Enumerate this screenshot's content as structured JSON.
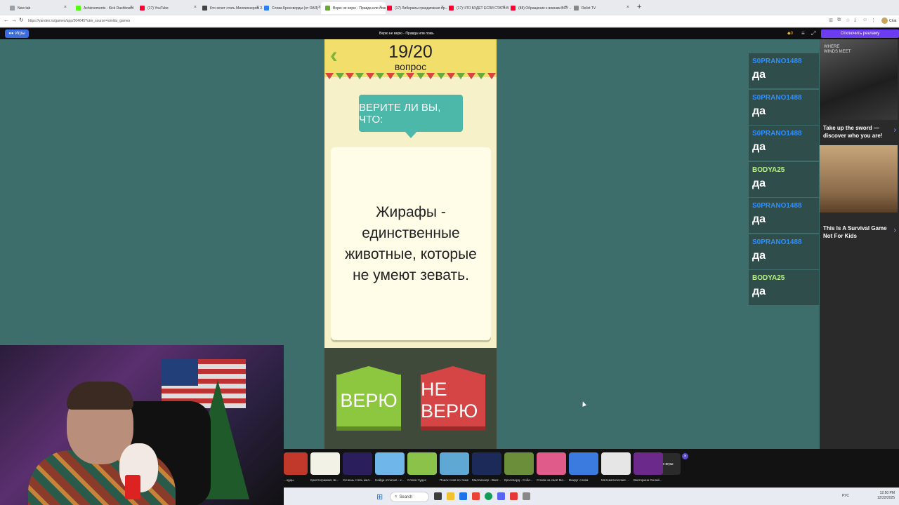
{
  "browser": {
    "tabs": [
      {
        "label": "New tab",
        "color": "#9aa0a6"
      },
      {
        "label": "Achievements - Kick Dashboard",
        "color": "#53fc18"
      },
      {
        "label": "(17) YouTube",
        "color": "#ff0033"
      },
      {
        "label": "Кто хочет стать Миллионером 2...",
        "color": "#444444"
      },
      {
        "label": "Слова Кроссворды (от ОАЯ) - ...",
        "color": "#2f80ed"
      },
      {
        "label": "Верю не верю - Правда или лож...",
        "color": "#6aa83a"
      },
      {
        "label": "(17) Либералы грандиозная ор...",
        "color": "#ff0033"
      },
      {
        "label": "(17) ЧТО БУДЕТ ЕСЛИ СТАТЬ В U...",
        "color": "#ff0033"
      },
      {
        "label": "(88) Обращение к воинам ВСУ ...",
        "color": "#ff0033"
      },
      {
        "label": "Relict TV",
        "color": "#888888"
      }
    ],
    "active_tab": 5,
    "new_tab": "+",
    "url": "https://yandex.ru/games/app/264645?utm_source=similar_games",
    "profile": "Chat"
  },
  "header": {
    "logo": "Игры",
    "title": "Верю не верю - Правда или ложь",
    "coins": "0",
    "noads": "Отключить рекламу"
  },
  "game": {
    "progress": "19/20",
    "progress_word": "вопрос",
    "prompt": "ВЕРИТЕ ЛИ ВЫ, ЧТО:",
    "statement": "Жирафы -\nединственные\nживотные, которые\nне умеют зевать.",
    "yes": "ВЕРЮ",
    "no": "НЕ ВЕРЮ"
  },
  "chat": [
    {
      "user": "S0PRANO1488",
      "text": "да",
      "color": "#2e8fff"
    },
    {
      "user": "S0PRANO1488",
      "text": "да",
      "color": "#2e8fff"
    },
    {
      "user": "S0PRANO1488",
      "text": "да",
      "color": "#2e8fff"
    },
    {
      "user": "BODYA25",
      "text": "да",
      "color": "#b7f08a"
    },
    {
      "user": "S0PRANO1488",
      "text": "да",
      "color": "#2e8fff"
    },
    {
      "user": "S0PRANO1488",
      "text": "да",
      "color": "#2e8fff"
    },
    {
      "user": "BODYA25",
      "text": "да",
      "color": "#b7f08a"
    }
  ],
  "ads": [
    {
      "text": "Take up the sword — discover who you are!",
      "caption": "WHERE WINDS MEET"
    },
    {
      "text": "This Is A Survival Game Not For Kids",
      "caption": ""
    }
  ],
  "strip": {
    "games": [
      {
        "label": "...орды",
        "color": "#c0392b"
      },
      {
        "label": "Криптограмма: Ш...",
        "color": "#f2f2e6"
      },
      {
        "label": "Хочешь стать мил...",
        "color": "#2a1e5c"
      },
      {
        "label": "Найди отличия - к...",
        "color": "#6fb7e8"
      },
      {
        "label": "Слова Чудес",
        "color": "#8bc34a"
      },
      {
        "label": "Поиск слов по теме",
        "color": "#5fa8d3"
      },
      {
        "label": "Миллионер - Викт...",
        "color": "#1c2a5a"
      },
      {
        "label": "Кроссворд - Собе...",
        "color": "#6a8e3a"
      },
      {
        "label": "Слова на своё Ме...",
        "color": "#e05a8a"
      },
      {
        "label": "Вокруг слова",
        "color": "#3b7be0"
      },
      {
        "label": "Математические ...",
        "color": "#e6e6e6"
      },
      {
        "label": "Викторина Онлай...",
        "color": "#6b2a8a"
      }
    ],
    "all": "Все игры",
    "close": "×"
  },
  "taskbar": {
    "search": "Search",
    "lang": "РУС",
    "time": "12:50 PM",
    "date": "12/22/2025"
  }
}
